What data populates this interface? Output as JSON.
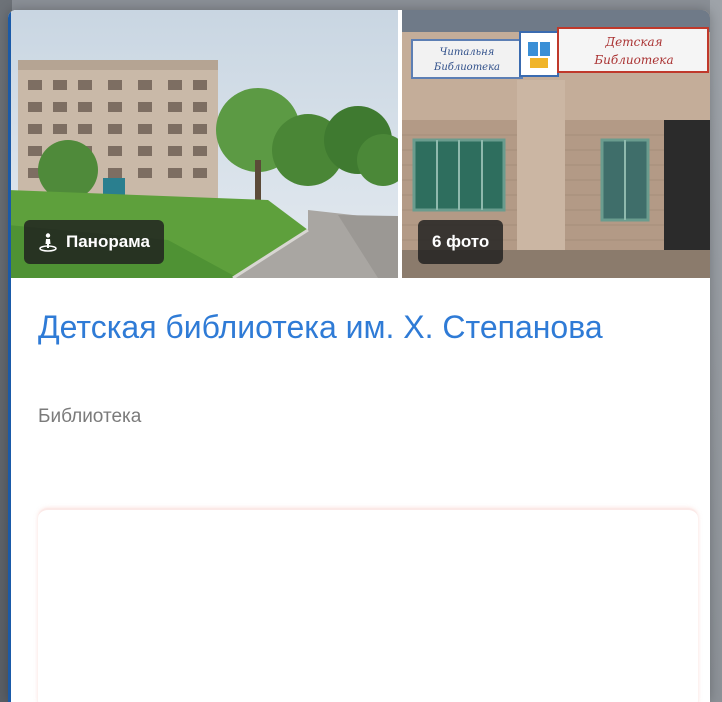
{
  "card": {
    "panorama_label": "Панорама",
    "photos_label": "6 фото",
    "title": "Детская библиотека им. Х. Степанова",
    "category": "Библиотека"
  },
  "icons": {
    "panorama": "panorama-person-icon"
  },
  "signs": {
    "left_line1": "Читальня",
    "left_line2": "Библиотека",
    "right_line1": "Детская",
    "right_line2": "Библиотека"
  },
  "colors": {
    "title": "#2f7bd6",
    "category": "#7b7b7b",
    "chip_bg": "#1e1e1e",
    "accent": "#1a5aa8"
  }
}
